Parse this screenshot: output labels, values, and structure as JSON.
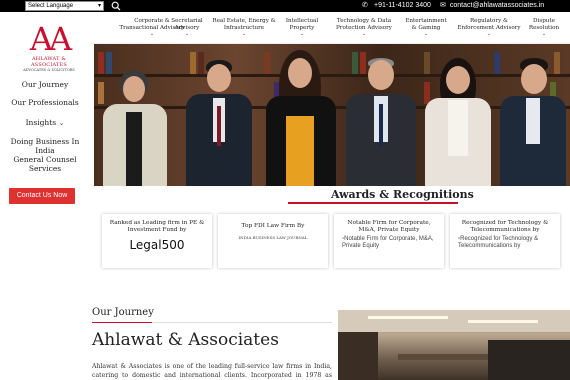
{
  "topbar": {
    "language_select": "Select Language",
    "phone": "+91-11-4102 3400",
    "email": "contact@ahlawatassociates.in"
  },
  "logo": {
    "mark": "AA",
    "name": "AHLAWAT & ASSOCIATES",
    "tagline": "ADVOCATES & SOLICITORS"
  },
  "sidebar": {
    "items": [
      "Our Journey",
      "Our Professionals",
      "Insights",
      "Doing Business In India",
      "General Counsel Services"
    ],
    "contact_button": "Contact Us Now"
  },
  "mainnav": {
    "items": [
      {
        "line1": "Corporate &",
        "line2": "Transactional Advisory"
      },
      {
        "line1": "Secretarial",
        "line2": "Advisory"
      },
      {
        "line1": "Real Estate, Energy &",
        "line2": "Infrastructure"
      },
      {
        "line1": "Intellectual",
        "line2": "Property"
      },
      {
        "line1": "Technology & Data",
        "line2": "Protection Advisory"
      },
      {
        "line1": "Entertainment",
        "line2": "& Gaming"
      },
      {
        "line1": "Regulatory &",
        "line2": "Enforcement Advisory"
      },
      {
        "line1": "Dispute",
        "line2": "Resolution"
      }
    ]
  },
  "awards": {
    "title": "Awards & Recognitions",
    "cards": [
      {
        "title": "Ranked as Leading firm in PE & Investment Fund by",
        "logo_text": "Legal500"
      },
      {
        "title": "Top FDI Law Firm By",
        "logo_text": "INDIA BUSINESS LAW JOURNAL"
      },
      {
        "title": "Notable Firm for Corporate, M&A, Private Equity",
        "alt_text": "Notable Firm for Corporate, M&A, Private Equity"
      },
      {
        "title": "Recognized for Technology & Telecommunications by",
        "alt_text": "Recognized for Technology & Telecommunications by"
      }
    ]
  },
  "journey": {
    "label": "Our Journey",
    "title": "Ahlawat & Associates",
    "text": "Ahlawat & Associates is one of the leading full-service law firms in India, catering to domestic and international clients. Incorporated in 1978 as primarily a"
  }
}
